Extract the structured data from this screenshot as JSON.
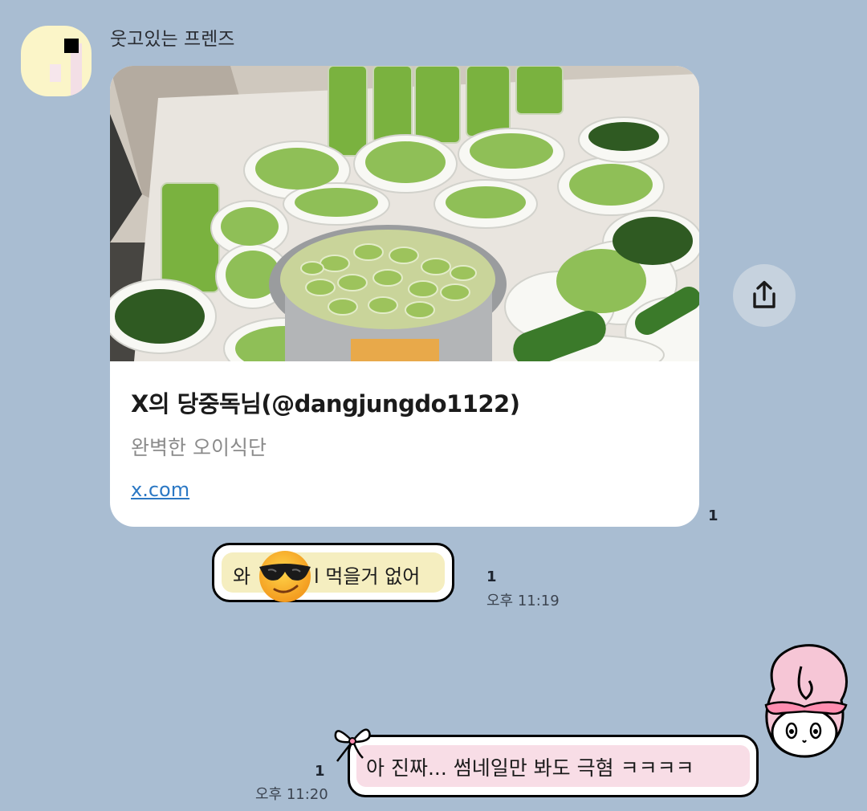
{
  "chat": {
    "sender_name": "웃고있는 프렌즈",
    "link_card": {
      "title": "X의 당중독님(@dangjungdo1122)",
      "description": "완벽한 오이식단",
      "domain": "x.com",
      "unread": "1"
    },
    "share_icon": "share-upload-icon",
    "message1": {
      "text_before": "와",
      "emoji": "sunglasses-face-emoji",
      "text_after": "l 먹을거 없어",
      "unread": "1",
      "time": "오후 11:19"
    },
    "message2": {
      "text": "아 진짜... 썸네일만 봐도 극혐 ㅋㅋㅋㅋ",
      "unread": "1",
      "time": "오후 11:20"
    }
  },
  "colors": {
    "background": "#a9bdd2",
    "bubble1_fill": "#f5eec0",
    "bubble2_fill": "#f8dde6",
    "link": "#2b78c4"
  }
}
